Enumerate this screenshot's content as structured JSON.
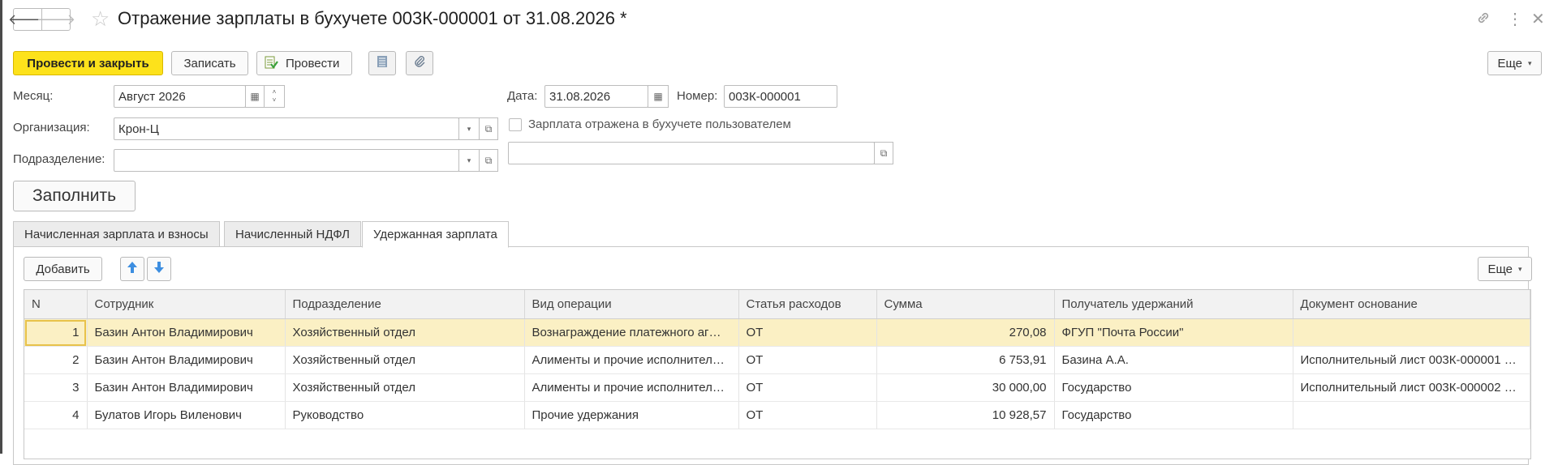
{
  "window": {
    "title": "Отражение зарплаты в бухучете 003К-000001 от 31.08.2026 *"
  },
  "toolbar": {
    "post_close": "Провести и закрыть",
    "save": "Записать",
    "post": "Провести",
    "more": "Еще"
  },
  "form": {
    "month_label": "Месяц:",
    "month_value": "Август 2026",
    "date_label": "Дата:",
    "date_value": "31.08.2026",
    "number_label": "Номер:",
    "number_value": "003К-000001",
    "org_label": "Организация:",
    "org_value": "Крон-Ц",
    "checkbox_label": "Зарплата отражена в бухучете пользователем",
    "dept_label": "Подразделение:",
    "dept_value": "",
    "extra_value": "",
    "fill_button": "Заполнить"
  },
  "tabs": [
    {
      "label": "Начисленная зарплата и взносы"
    },
    {
      "label": "Начисленный НДФЛ"
    },
    {
      "label": "Удержанная зарплата"
    }
  ],
  "grid_toolbar": {
    "add": "Добавить",
    "more": "Еще"
  },
  "table": {
    "columns": [
      "N",
      "Сотрудник",
      "Подразделение",
      "Вид операции",
      "Статья расходов",
      "Сумма",
      "Получатель удержаний",
      "Документ основание"
    ],
    "rows": [
      [
        "1",
        "Базин Антон Владимирович",
        "Хозяйственный отдел",
        "Вознаграждение платежного аг…",
        "ОТ",
        "270,08",
        "ФГУП \"Почта России\"",
        ""
      ],
      [
        "2",
        "Базин Антон Владимирович",
        "Хозяйственный отдел",
        "Алименты и прочие исполнител…",
        "ОТ",
        "6 753,91",
        "Базина А.А.",
        "Исполнительный лист 003К-000001 …"
      ],
      [
        "3",
        "Базин Антон Владимирович",
        "Хозяйственный отдел",
        "Алименты и прочие исполнител…",
        "ОТ",
        "30 000,00",
        "Государство",
        "Исполнительный лист 003К-000002 …"
      ],
      [
        "4",
        "Булатов Игорь Виленович",
        "Руководство",
        "Прочие удержания",
        "ОТ",
        "10 928,57",
        "Государство",
        ""
      ]
    ]
  },
  "colors": {
    "primary_button": "#fde21b",
    "selected_row": "#fbf0c4",
    "arrow_blue": "#3d8ee0"
  }
}
